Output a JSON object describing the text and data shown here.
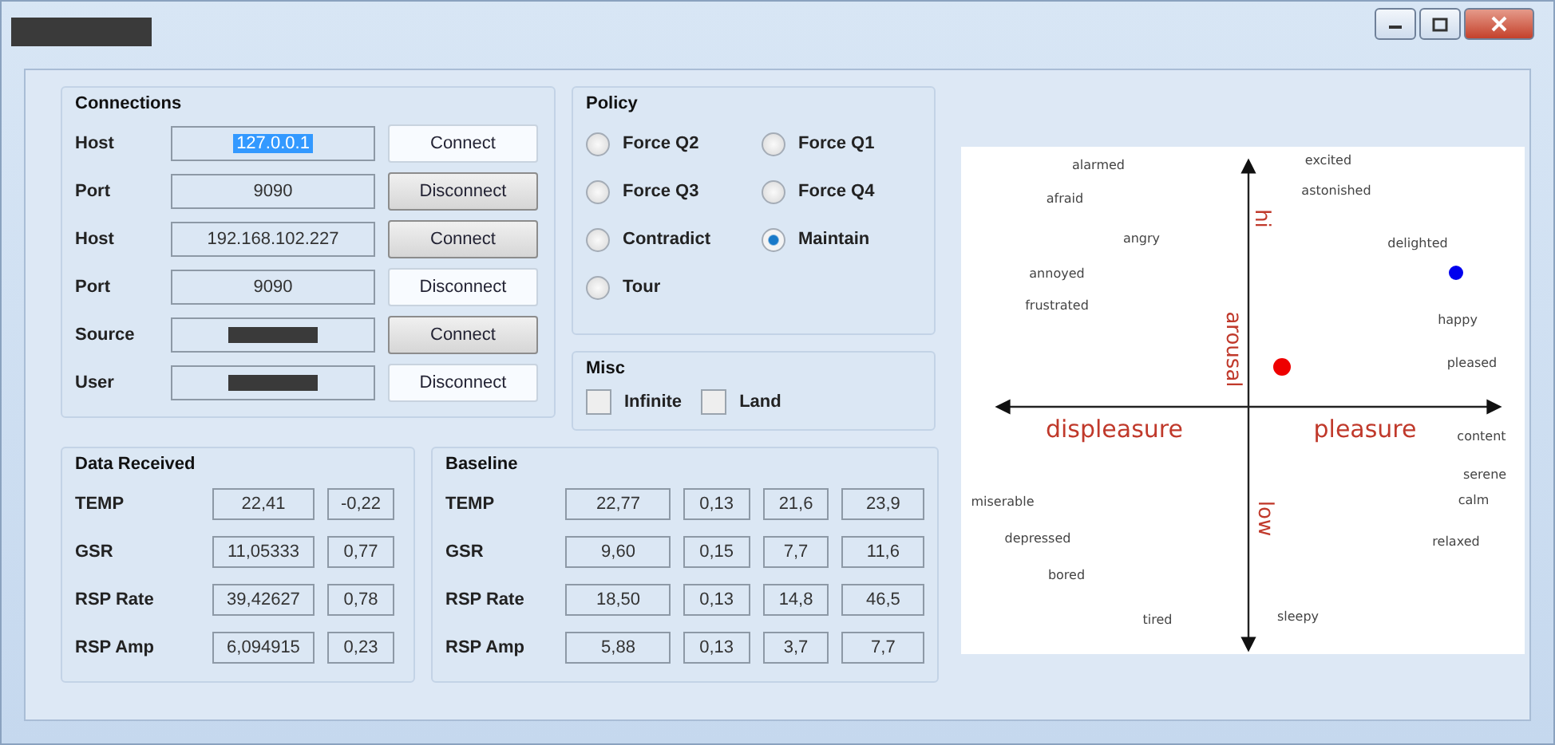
{
  "window": {
    "title_redacted": true,
    "controls": [
      {
        "kind": "minimize"
      },
      {
        "kind": "maximize"
      },
      {
        "kind": "close"
      }
    ]
  },
  "connections": {
    "title": "Connections",
    "rows": [
      {
        "label": "Host",
        "kind": "text",
        "value": "127.0.0.1",
        "highlighted": true,
        "button": "Connect",
        "pressed": false
      },
      {
        "label": "Port",
        "kind": "text",
        "value": "9090",
        "highlighted": false,
        "button": "Disconnect",
        "pressed": true
      },
      {
        "label": "Host",
        "kind": "text",
        "value": "192.168.102.227",
        "highlighted": false,
        "button": "Connect",
        "pressed": true
      },
      {
        "label": "Port",
        "kind": "text",
        "value": "9090",
        "highlighted": false,
        "button": "Disconnect",
        "pressed": false
      },
      {
        "label": "Source",
        "kind": "redacted",
        "button": "Connect",
        "pressed": true
      },
      {
        "label": "User",
        "kind": "redacted",
        "button": "Disconnect",
        "pressed": false
      }
    ]
  },
  "policy": {
    "title": "Policy",
    "options": [
      {
        "label": "Force Q2",
        "selected": false
      },
      {
        "label": "Force Q1",
        "selected": false
      },
      {
        "label": "Force Q3",
        "selected": false
      },
      {
        "label": "Force Q4",
        "selected": false
      },
      {
        "label": "Contradict",
        "selected": false
      },
      {
        "label": "Maintain",
        "selected": true
      },
      {
        "label": "Tour",
        "selected": false
      }
    ]
  },
  "misc": {
    "title": "Misc",
    "options": [
      {
        "label": "Infinite",
        "checked": false
      },
      {
        "label": "Land",
        "checked": false
      }
    ]
  },
  "data_received": {
    "title": "Data Received",
    "rows": [
      {
        "label": "TEMP",
        "values": [
          "22,41",
          "-0,22"
        ]
      },
      {
        "label": "GSR",
        "values": [
          "11,05333",
          "0,77"
        ]
      },
      {
        "label": "RSP Rate",
        "values": [
          "39,42627",
          "0,78"
        ]
      },
      {
        "label": "RSP Amp",
        "values": [
          "6,094915",
          "0,23"
        ]
      }
    ]
  },
  "baseline": {
    "title": "Baseline",
    "rows": [
      {
        "label": "TEMP",
        "values": [
          "22,77",
          "0,13",
          "21,6",
          "23,9"
        ]
      },
      {
        "label": "GSR",
        "values": [
          "9,60",
          "0,15",
          "7,7",
          "11,6"
        ]
      },
      {
        "label": "RSP Rate",
        "values": [
          "18,50",
          "0,13",
          "14,8",
          "46,5"
        ]
      },
      {
        "label": "RSP Amp",
        "values": [
          "5,88",
          "0,13",
          "3,7",
          "7,7"
        ]
      }
    ]
  },
  "circumplex": {
    "axis_labels": [
      "hi",
      "arousal",
      "low",
      "displeasure",
      "pleasure"
    ],
    "words": [
      "alarmed",
      "afraid",
      "angry",
      "annoyed",
      "frustrated",
      "excited",
      "astonished",
      "delighted",
      "happy",
      "pleased",
      "content",
      "serene",
      "calm",
      "relaxed",
      "miserable",
      "depressed",
      "bored",
      "tired",
      "sleepy"
    ],
    "markers": [
      {
        "color": "#ee0000"
      },
      {
        "color": "#0000ee"
      }
    ]
  }
}
